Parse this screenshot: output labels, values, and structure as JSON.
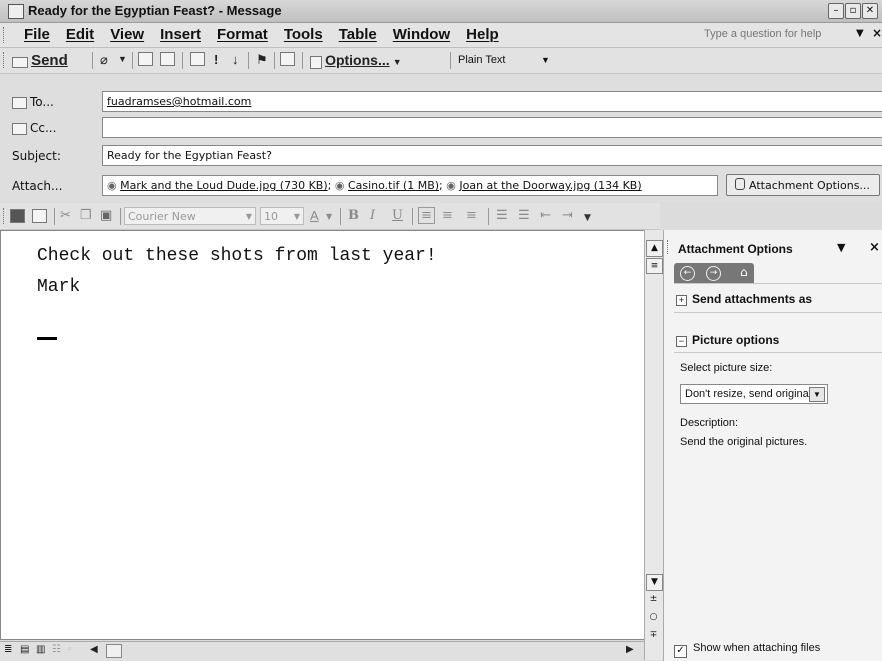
{
  "window": {
    "title": "Ready for the Egyptian Feast? - Message",
    "buttons": [
      "–",
      "▫",
      "✕"
    ]
  },
  "menu": {
    "items": [
      "File",
      "Edit",
      "View",
      "Insert",
      "Format",
      "Tools",
      "Table",
      "Window",
      "Help"
    ],
    "help_placeholder": "Type a question for help"
  },
  "toolbar": {
    "send_label": "Send",
    "options_label": "Options...",
    "format_value": "Plain Text"
  },
  "header": {
    "to_label": "To...",
    "to_value": "fuadramses@hotmail.com",
    "cc_label": "Cc...",
    "cc_value": "",
    "subject_label": "Subject:",
    "subject_value": "Ready for the Egyptian Feast?",
    "attach_label": "Attach...",
    "attachments": [
      {
        "name": "Mark and the Loud Dude.jpg (730 KB)",
        "sep": ";"
      },
      {
        "name": "Casino.tif (1 MB)",
        "sep": ";"
      },
      {
        "name": "Joan at the Doorway.jpg (134 KB)",
        "sep": ""
      }
    ],
    "attach_options_label": "Attachment Options..."
  },
  "formatting": {
    "font": "Courier New",
    "size": "10"
  },
  "body": {
    "lines": [
      "Check out these shots from last year!",
      "",
      "Mark"
    ]
  },
  "pane": {
    "title": "Attachment Options",
    "send_attachments_as": "Send attachments as",
    "picture_options": "Picture options",
    "select_size_label": "Select picture size:",
    "size_value": "Don't resize, send originals",
    "description_label": "Description:",
    "description_text": "Send the original pictures.",
    "show_when_attaching": "Show when attaching files",
    "show_checked": true
  }
}
